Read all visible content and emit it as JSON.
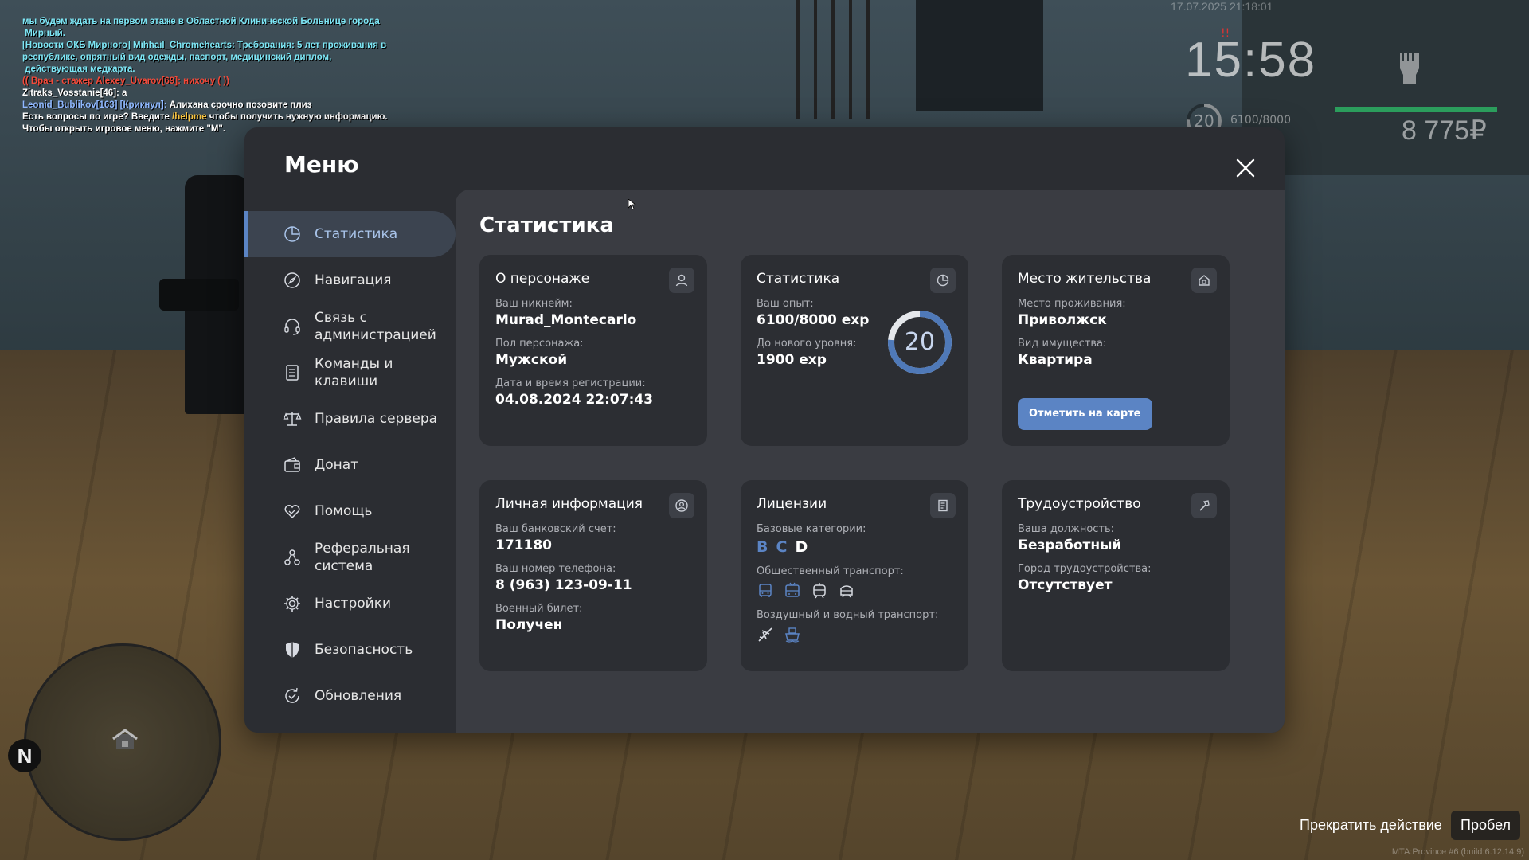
{
  "chat": [
    {
      "color": "c-cyan",
      "text": "мы будем ждать на первом этаже в Областной Клинической Больнице города\n Мирный."
    },
    {
      "color": "c-cyan",
      "text": "[Новости ОКБ Мирного] Mihhail_Chromehearts: Требования: 5 лет проживания в\nреспублике, опрятный вид одежды, паспорт, медицинский диплом,\n действующая медкарта."
    },
    {
      "color": "c-red",
      "text": "(( Врач - стажер Alexey_Uvarov[69]: нихочу ( ))"
    },
    {
      "color": "c-white",
      "text": "Zitraks_Vosstanie[46]: а"
    },
    {
      "parts": [
        {
          "color": "c-blue",
          "text": "Leonid_Bublikov[163] [Крикнул]: "
        },
        {
          "color": "c-white",
          "text": "Алихана срочно позовите плиз"
        }
      ]
    },
    {
      "parts": [
        {
          "color": "c-white",
          "text": "Есть вопросы по игре? Введите "
        },
        {
          "color": "c-yellow",
          "text": "/helpme"
        },
        {
          "color": "c-white",
          "text": " чтобы получить нужную информацию."
        }
      ]
    },
    {
      "color": "c-white",
      "text": "Чтобы открыть игровое меню, нажмите \"M\"."
    }
  ],
  "hud": {
    "date": "17.07.2025 21:18:01",
    "mark": "!!",
    "time": "15:58",
    "level": "20",
    "exp": "6100/8000",
    "money": "8 775₽",
    "health_fraction": 1.0,
    "fist_icon": "fist-icon"
  },
  "minimap": {
    "compass": "N"
  },
  "action": {
    "label": "Прекратить действие",
    "key": "Пробел"
  },
  "watermark": "MTA:Province #6 (build:6.12.14.9)",
  "menu": {
    "title": "Меню",
    "nav": [
      {
        "label": "Статистика",
        "icon": "pie-chart-icon",
        "active": true
      },
      {
        "label": "Навигация",
        "icon": "compass-icon"
      },
      {
        "label": "Связь с\nадминистрацией",
        "icon": "headset-icon"
      },
      {
        "label": "Команды и\nклавиши",
        "icon": "list-icon"
      },
      {
        "label": "Правила сервера",
        "icon": "scales-icon"
      },
      {
        "label": "Донат",
        "icon": "wallet-icon"
      },
      {
        "label": "Помощь",
        "icon": "heart-hand-icon"
      },
      {
        "label": "Реферальная\nсистема",
        "icon": "network-icon"
      },
      {
        "label": "Настройки",
        "icon": "gear-icon"
      },
      {
        "label": "Безопасность",
        "icon": "shield-icon"
      },
      {
        "label": "Обновления",
        "icon": "refresh-check-icon"
      }
    ],
    "content_title": "Статистика",
    "cards": {
      "character": {
        "title": "О персонаже",
        "nick_label": "Ваш никнейм:",
        "nick": "Murad_Montecarlo",
        "gender_label": "Пол персонажа:",
        "gender": "Мужской",
        "reg_label": "Дата и время регистрации:",
        "reg": "04.08.2024 22:07:43"
      },
      "stats": {
        "title": "Статистика",
        "exp_label": "Ваш опыт:",
        "exp": "6100/8000 exp",
        "next_label": "До нового уровня:",
        "next": "1900 exp",
        "level": "20",
        "progress": 0.7625
      },
      "residence": {
        "title": "Место жительства",
        "place_label": "Место проживания:",
        "place": "Приволжск",
        "property_label": "Вид имущества:",
        "property": "Квартира",
        "button": "Отметить на карте"
      },
      "personal": {
        "title": "Личная информация",
        "bank_label": "Ваш банковский счет:",
        "bank": "171180",
        "phone_label": "Ваш номер телефона:",
        "phone": "8 (963) 123-09-11",
        "military_label": "Военный билет:",
        "military": "Получен"
      },
      "licenses": {
        "title": "Лицензии",
        "base_label": "Базовые категории:",
        "categories": [
          {
            "name": "B",
            "owned": false
          },
          {
            "name": "C",
            "owned": false
          },
          {
            "name": "D",
            "owned": true
          }
        ],
        "public_label": "Общественный транспорт:",
        "public_icons": [
          "bus-icon",
          "trolleybus-icon",
          "tram-icon",
          "metro-icon"
        ],
        "air_label": "Воздушный и водный транспорт:",
        "air_icons": [
          "plane-icon",
          "boat-icon"
        ]
      },
      "job": {
        "title": "Трудоустройство",
        "position_label": "Ваша должность:",
        "position": "Безработный",
        "city_label": "Город трудоустройства:",
        "city": "Отсутствует"
      }
    }
  }
}
